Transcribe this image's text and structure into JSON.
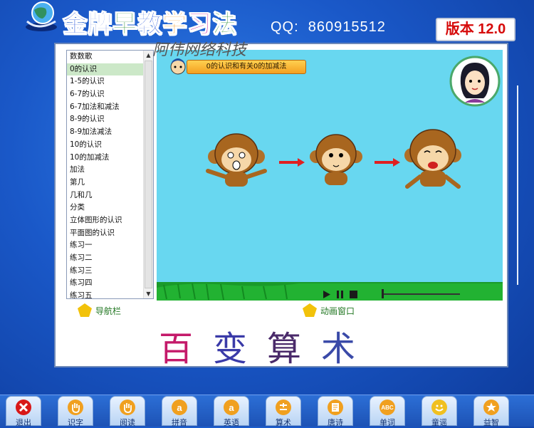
{
  "header": {
    "brand_chars": [
      {
        "char": "金",
        "color": "#1f4fd8"
      },
      {
        "char": "牌",
        "color": "#1f4fd8"
      },
      {
        "char": "早",
        "color": "#1f8a2a"
      },
      {
        "char": "教",
        "color": "#1f4fd8"
      },
      {
        "char": "学",
        "color": "#f09010"
      },
      {
        "char": "习",
        "color": "#c41a9a"
      },
      {
        "char": "法",
        "color": "#1f8a2a"
      }
    ],
    "qq_label": "QQ:",
    "qq_number": "860915512",
    "version": "版本 12.0"
  },
  "watermark": "阿伟网络科技",
  "nav": {
    "active_index": 1,
    "items": [
      "数数歌",
      "0的认识",
      "1-5的认识",
      "6-7的认识",
      "6-7加法和减法",
      "8-9的认识",
      "8-9加法减法",
      "10的认识",
      "10的加减法",
      "加法",
      "第几",
      "几和几",
      "分类",
      "立体图形的认识",
      "平面图的认识",
      "练习一",
      "练习二",
      "练习三",
      "练习四",
      "练习五"
    ]
  },
  "lesson": {
    "title": "0的认识和有关0的加减法"
  },
  "labels": {
    "nav_bar": "导航栏",
    "animation_window": "动画窗口"
  },
  "banner": {
    "chars": [
      {
        "char": "百",
        "color": "#c41a6a"
      },
      {
        "char": "变",
        "color": "#3a3aa8"
      },
      {
        "char": "算",
        "color": "#4a2a6a"
      },
      {
        "char": "术",
        "color": "#3a4aa8"
      }
    ]
  },
  "toolbar": {
    "buttons": [
      {
        "label": "退出",
        "icon": "exit-icon"
      },
      {
        "label": "识字",
        "icon": "hand-icon"
      },
      {
        "label": "阅读",
        "icon": "hand-icon"
      },
      {
        "label": "拼音",
        "icon": "a-icon"
      },
      {
        "label": "英语",
        "icon": "a-icon"
      },
      {
        "label": "算术",
        "icon": "calc-icon"
      },
      {
        "label": "唐诗",
        "icon": "poem-icon"
      },
      {
        "label": "单词",
        "icon": "abc-icon"
      },
      {
        "label": "童谣",
        "icon": "smile-icon"
      },
      {
        "label": "益智",
        "icon": "star-icon"
      }
    ]
  },
  "colors": {
    "animation_bg": "#68d7f0",
    "accent_red": "#d60a0a"
  }
}
